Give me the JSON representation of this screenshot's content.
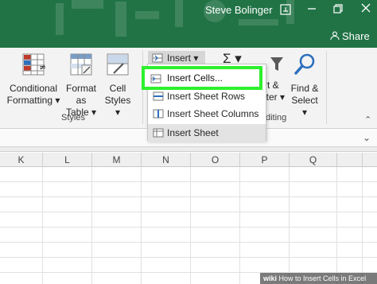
{
  "titlebar": {
    "user_name": "Steve Bolinger",
    "share_label": "Share",
    "icons": [
      "account-icon",
      "restore-ribbon-icon",
      "restore-window-icon",
      "share-icon"
    ]
  },
  "ribbon": {
    "conditional_formatting": {
      "line1": "Conditional",
      "line2": "Formatting ▾"
    },
    "format_as_table": {
      "line1": "Format as",
      "line2": "Table ▾"
    },
    "cell_styles": {
      "line1": "Cell",
      "line2": "Styles ▾"
    },
    "styles_group_label": "Styles",
    "insert_label": "Insert ▾",
    "sum_symbol": "Σ ▾",
    "sort_partial": {
      "line1": "rt &",
      "line2": "lter ▾"
    },
    "find_select": {
      "line1": "Find &",
      "line2": "Select ▾"
    },
    "editing_group_partial": "diting"
  },
  "insert_menu": {
    "items": [
      {
        "label": "Insert Cells...",
        "icon": "insert-cells-icon"
      },
      {
        "label": "Insert Sheet Rows",
        "icon": "insert-rows-icon"
      },
      {
        "label": "Insert Sheet Columns",
        "icon": "insert-columns-icon"
      },
      {
        "label": "Insert Sheet",
        "icon": "insert-sheet-icon"
      }
    ],
    "highlight_color": "#2df02d"
  },
  "grid": {
    "columns": [
      "K",
      "L",
      "M",
      "N",
      "O",
      "P",
      "Q"
    ]
  },
  "watermark": {
    "prefix": "wiki",
    "text": "How to Insert Cells in Excel"
  },
  "colors": {
    "excel_green": "#217346",
    "ribbon_bg": "#f3f3f3"
  }
}
